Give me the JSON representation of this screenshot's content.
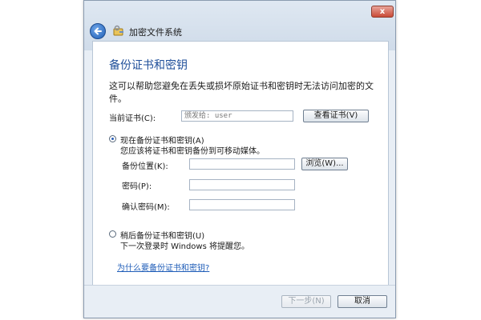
{
  "window": {
    "title": "加密文件系统",
    "close_label": "x"
  },
  "page": {
    "heading": "备份证书和密钥",
    "description": "这可以帮助您避免在丢失或损坏原始证书和密钥时无法访问加密的文件。"
  },
  "current_cert": {
    "label": "当前证书(C):",
    "value": "颁发给: user",
    "view_button": "查看证书(V)"
  },
  "option_now": {
    "title": "现在备份证书和密钥(A)",
    "subtitle": "您应该将证书和密钥备份到可移动媒体。",
    "selected": true,
    "backup_location_label": "备份位置(K):",
    "backup_location_value": "",
    "browse_button": "浏览(W)...",
    "password_label": "密码(P):",
    "password_value": "",
    "confirm_label": "确认密码(M):",
    "confirm_value": ""
  },
  "option_later": {
    "title": "稍后备份证书和密钥(U)",
    "subtitle": "下一次登录时 Windows 将提醒您。",
    "selected": false
  },
  "help_link": "为什么要备份证书和密钥?",
  "footer": {
    "next_button": "下一步(N)",
    "cancel_button": "取消"
  }
}
